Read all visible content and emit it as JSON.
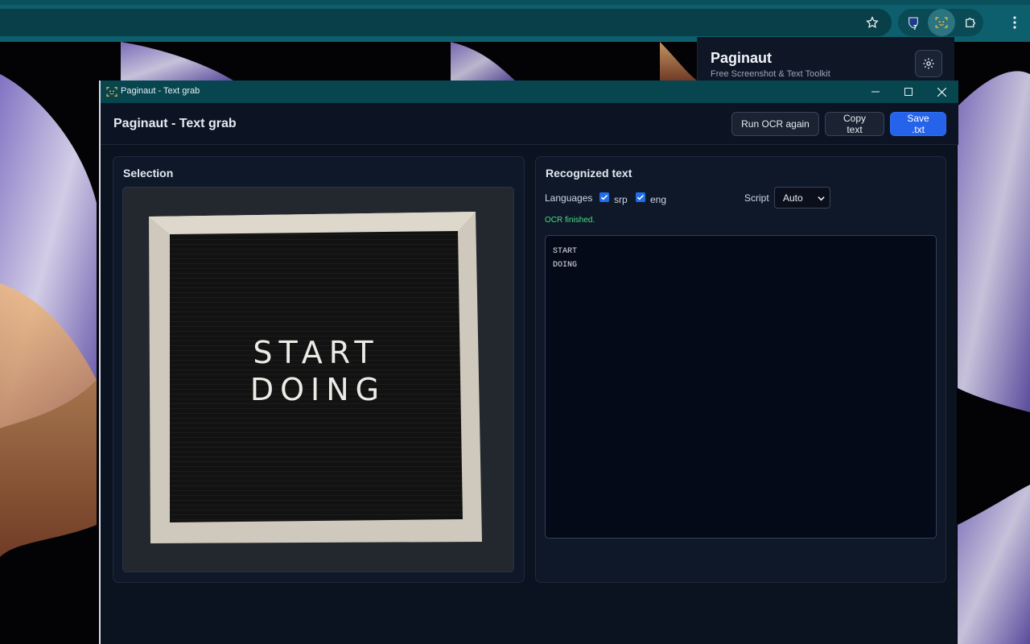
{
  "popup": {
    "title": "Paginaut",
    "subtitle": "Free Screenshot & Text Toolkit"
  },
  "toolbar": {
    "bitwarden_badge": "7",
    "icons": [
      "star-icon",
      "bitwarden-icon",
      "paginaut-icon",
      "puzzle-icon",
      "menu-icon"
    ]
  },
  "window": {
    "title": "Paginaut - Text grab"
  },
  "header": {
    "title": "Paginaut - Text grab",
    "run_ocr_label": "Run OCR again",
    "copy_text_label": "Copy text",
    "save_txt_label": "Save .txt"
  },
  "selection": {
    "title": "Selection",
    "board_line1": "START",
    "board_line2": "DOING"
  },
  "recognized": {
    "title": "Recognized text",
    "languages_label": "Languages",
    "languages": [
      {
        "code": "srp",
        "checked": true
      },
      {
        "code": "eng",
        "checked": true
      }
    ],
    "script_label": "Script",
    "script_value": "Auto",
    "status": "OCR finished.",
    "text": "START\nDOING"
  },
  "colors": {
    "accent": "#2563eb",
    "status_ok": "#4ade80",
    "titlebar": "#07454f",
    "browser_bar": "#0d5f6d"
  }
}
